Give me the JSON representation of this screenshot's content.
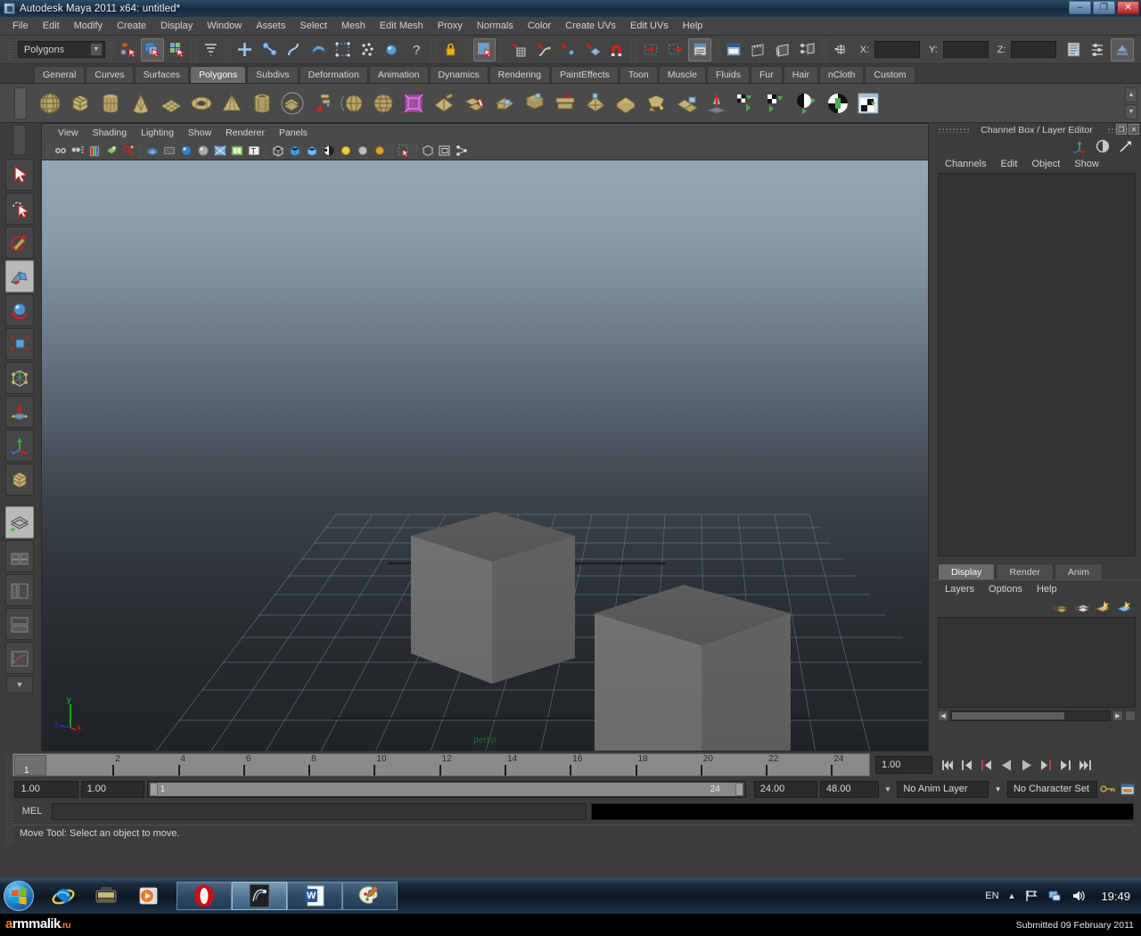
{
  "window": {
    "title": "Autodesk Maya 2011 x64: untitled*",
    "minimize": "–",
    "maximize": "❐",
    "close": "✕"
  },
  "menubar": {
    "items": [
      "File",
      "Edit",
      "Modify",
      "Create",
      "Display",
      "Window",
      "Assets",
      "Select",
      "Mesh",
      "Edit Mesh",
      "Proxy",
      "Normals",
      "Color",
      "Create UVs",
      "Edit UVs",
      "Help"
    ]
  },
  "statusline": {
    "menuset": "Polygons",
    "x_label": "X:",
    "y_label": "Y:",
    "z_label": "Z:",
    "x_value": "",
    "y_value": "",
    "z_value": "",
    "icons": [
      "select-by-hierarchy-icon",
      "select-by-object-icon",
      "select-by-component-icon",
      "select-mask-icon",
      "select-handle-icon",
      "select-joint-icon",
      "select-curve-icon",
      "select-surface-icon",
      "select-deformation-icon",
      "select-dynamic-icon",
      "select-rendering-icon",
      "select-misc-icon",
      "lock-selection-icon",
      "highlight-icon",
      "snap-grid-icon",
      "snap-curve-icon",
      "snap-point-icon",
      "snap-plane-icon",
      "snap-magnet-icon",
      "construction-history-input-icon",
      "construction-history-output-icon",
      "construction-history-icon",
      "render-current-frame-icon",
      "ipr-render-icon",
      "render-settings-icon",
      "hypershade-icon",
      "channel-box-toggle-icon",
      "attribute-editor-toggle-icon",
      "tool-settings-icon"
    ]
  },
  "shelf": {
    "tabs": [
      "General",
      "Curves",
      "Surfaces",
      "Polygons",
      "Subdivs",
      "Deformation",
      "Animation",
      "Dynamics",
      "Rendering",
      "PaintEffects",
      "Toon",
      "Muscle",
      "Fluids",
      "Fur",
      "Hair",
      "nCloth",
      "Custom"
    ],
    "active_tab": "Polygons",
    "icons": [
      "poly-sphere-icon",
      "poly-cube-icon",
      "poly-cylinder-icon",
      "poly-cone-icon",
      "poly-plane-icon",
      "poly-torus-icon",
      "poly-pyramid-icon",
      "poly-pipe-icon",
      "poly-soccer-ball-icon",
      "poly-helix-icon",
      "poly-platonic-icon",
      "poly-sphere2-icon",
      "poly-cube2-icon",
      "interactive-split-icon",
      "poly-extrude-icon",
      "poly-wedge-icon",
      "poly-bevel-icon",
      "poly-bridge-icon",
      "poly-append-icon",
      "poly-combine-icon",
      "poly-smooth-icon",
      "poly-mirror-icon",
      "poly-reduce-icon",
      "poly-triangulate-icon",
      "poly-sculpt-icon",
      "uv-planar-icon",
      "uv-cylindrical-icon",
      "uv-spherical-icon",
      "uv-automatic-icon",
      "uv-texture-editor-icon"
    ],
    "scroll_up": "▲",
    "scroll_down": "▼"
  },
  "toolbox": {
    "items": [
      {
        "name": "select-tool",
        "active": false
      },
      {
        "name": "lasso-tool",
        "active": false
      },
      {
        "name": "paint-selection-tool",
        "active": false
      },
      {
        "name": "move-tool",
        "active": true
      },
      {
        "name": "rotate-tool",
        "active": false
      },
      {
        "name": "scale-tool",
        "active": false
      },
      {
        "name": "universal-manipulator-tool",
        "active": false
      },
      {
        "name": "soft-modification-tool",
        "active": false
      },
      {
        "name": "show-manipulator-tool",
        "active": false
      },
      {
        "name": "last-tool-used",
        "active": false
      },
      {
        "name": "quick-layout-single-perspective",
        "active": true
      }
    ],
    "more_arrow": "▼"
  },
  "viewport": {
    "menus": [
      "View",
      "Shading",
      "Lighting",
      "Show",
      "Renderer",
      "Panels"
    ],
    "camera_label": "persp",
    "axis": {
      "y": "y",
      "x": "x",
      "z": "z"
    },
    "toolbar_icons": [
      "select-camera-icon",
      "camera-attributes-icon",
      "bookmark-icon",
      "image-plane-icon",
      "two-d-pan-zoom-icon",
      "grid-toggle-icon",
      "film-gate-icon",
      "resolution-gate-icon",
      "gate-mask-icon",
      "xray-icon",
      "xray-joints-icon",
      "wireframe-icon",
      "smooth-shade-icon",
      "shaded-textured-icon",
      "use-all-lights-icon",
      "shadows-icon",
      "default-light-icon",
      "all-lights-icon",
      "isolate-select-icon",
      "single-perspective-icon",
      "four-view-icon",
      "outliner-persp-icon"
    ]
  },
  "channelbox": {
    "title": "Channel Box / Layer Editor",
    "restore": "❐",
    "close": "✕",
    "menus": [
      "Channels",
      "Edit",
      "Object",
      "Show"
    ],
    "header_icons": [
      "channel-box-icon",
      "attribute-editor-icon",
      "layer-editor-icon"
    ],
    "layer_tabs": [
      "Display",
      "Render",
      "Anim"
    ],
    "layer_active_tab": "Display",
    "layer_menus": [
      "Layers",
      "Options",
      "Help"
    ],
    "layer_buttons": [
      "new-layer-icon",
      "new-layer-from-selected-icon",
      "layer-shade-icon",
      "layer-texture-icon"
    ],
    "scroll_left": "◀",
    "scroll_right": "▶"
  },
  "timeslider": {
    "ticks": [
      {
        "label": "2",
        "pos": 2
      },
      {
        "label": "4",
        "pos": 4
      },
      {
        "label": "6",
        "pos": 6
      },
      {
        "label": "8",
        "pos": 8
      },
      {
        "label": "10",
        "pos": 10
      },
      {
        "label": "12",
        "pos": 12
      },
      {
        "label": "14",
        "pos": 14
      },
      {
        "label": "16",
        "pos": 16
      },
      {
        "label": "18",
        "pos": 18
      },
      {
        "label": "20",
        "pos": 20
      },
      {
        "label": "22",
        "pos": 22
      },
      {
        "label": "24",
        "pos": 24
      }
    ],
    "current_frame": "1",
    "current_time_field": "1.00",
    "playback_buttons": [
      "go-to-start-icon",
      "step-back-key-icon",
      "step-back-frame-icon",
      "play-backwards-icon",
      "play-forwards-icon",
      "step-forward-frame-icon",
      "step-forward-key-icon",
      "go-to-end-icon"
    ]
  },
  "rangeslider": {
    "anim_start": "1.00",
    "range_start": "1.00",
    "bar_start": "1",
    "bar_end": "24",
    "range_end": "24.00",
    "anim_end": "48.00",
    "anim_layer": "No Anim Layer",
    "character_set": "No Character Set",
    "auto_key": "auto-key-icon",
    "anim_prefs": "animation-preferences-icon"
  },
  "command": {
    "mel_label": "MEL",
    "mel_value": "",
    "output_value": ""
  },
  "helpline": {
    "text": "Move Tool: Select an object to move."
  },
  "taskbar": {
    "start": "start-orb-icon",
    "quicklaunch": [
      "internet-explorer-icon",
      "media-center-icon",
      "media-player-icon"
    ],
    "tasks": [
      "opera-icon",
      "maya-icon",
      "word-icon",
      "paint-icon"
    ],
    "tray": {
      "language": "EN",
      "show_hidden": "▲",
      "icons": [
        "flag-action-center-icon",
        "network-icon",
        "volume-icon"
      ],
      "clock": "19:49"
    }
  },
  "footer": {
    "logo_prefix": "a",
    "logo_main": "rmmalik",
    "logo_suffix": ".ru",
    "submitted": "Submitted 09 February 2011"
  }
}
